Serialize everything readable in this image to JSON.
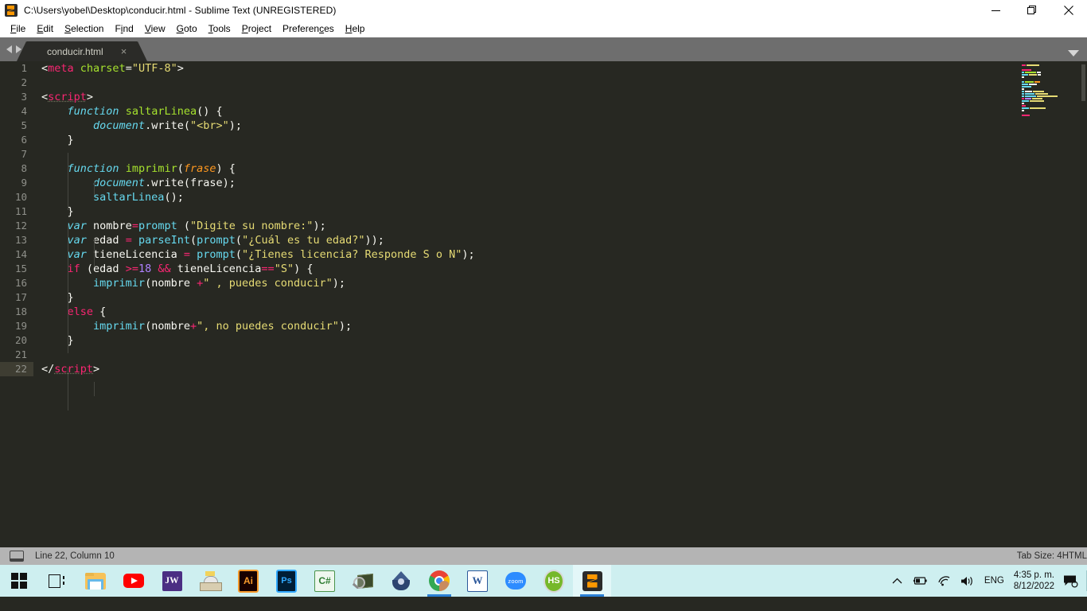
{
  "window": {
    "title": "C:\\Users\\yobel\\Desktop\\conducir.html - Sublime Text (UNREGISTERED)",
    "app_icon": "sublime-logo-icon",
    "controls": {
      "minimize": "minimize-icon",
      "restore": "restore-icon",
      "close": "close-icon"
    }
  },
  "menubar": {
    "items": [
      {
        "label": "File",
        "accel_index": 0
      },
      {
        "label": "Edit",
        "accel_index": 0
      },
      {
        "label": "Selection",
        "accel_index": 0
      },
      {
        "label": "Find",
        "accel_index": 1
      },
      {
        "label": "View",
        "accel_index": 0
      },
      {
        "label": "Goto",
        "accel_index": 0
      },
      {
        "label": "Tools",
        "accel_index": 0
      },
      {
        "label": "Project",
        "accel_index": 0
      },
      {
        "label": "Preferences",
        "accel_index": 8
      },
      {
        "label": "Help",
        "accel_index": 0
      }
    ]
  },
  "tabbar": {
    "nav_prev": "chevron-left-icon",
    "nav_next": "chevron-right-icon",
    "dropdown": "chevron-down-icon",
    "tabs": [
      {
        "label": "conducir.html",
        "active": true,
        "close": "×"
      }
    ]
  },
  "editor": {
    "active_line": 22,
    "lines": [
      {
        "n": 1,
        "tokens": [
          {
            "t": "&lt;",
            "c": "t-punct"
          },
          {
            "t": "meta",
            "c": "t-tag"
          },
          {
            "t": " ",
            "c": "t-plain"
          },
          {
            "t": "charset",
            "c": "t-attr"
          },
          {
            "t": "=",
            "c": "t-punct"
          },
          {
            "t": "\"UTF-8\"",
            "c": "t-str"
          },
          {
            "t": "&gt;",
            "c": "t-punct"
          }
        ]
      },
      {
        "n": 2,
        "tokens": []
      },
      {
        "n": 3,
        "tokens": [
          {
            "t": "&lt;",
            "c": "t-punct"
          },
          {
            "t": "script",
            "c": "t-tag u-dot"
          },
          {
            "t": "&gt;",
            "c": "t-punct"
          }
        ]
      },
      {
        "n": 4,
        "tokens": [
          {
            "t": "    ",
            "c": "t-plain"
          },
          {
            "t": "function",
            "c": "t-kw"
          },
          {
            "t": " ",
            "c": "t-plain"
          },
          {
            "t": "saltarLinea",
            "c": "t-fn"
          },
          {
            "t": "() {",
            "c": "t-plain"
          }
        ]
      },
      {
        "n": 5,
        "tokens": [
          {
            "t": "        ",
            "c": "t-plain"
          },
          {
            "t": "document",
            "c": "t-obj"
          },
          {
            "t": ".",
            "c": "t-plain"
          },
          {
            "t": "write",
            "c": "t-plain"
          },
          {
            "t": "(",
            "c": "t-plain"
          },
          {
            "t": "\"&lt;br&gt;\"",
            "c": "t-str"
          },
          {
            "t": ");",
            "c": "t-plain"
          }
        ]
      },
      {
        "n": 6,
        "tokens": [
          {
            "t": "    }",
            "c": "t-plain"
          }
        ]
      },
      {
        "n": 7,
        "tokens": []
      },
      {
        "n": 8,
        "tokens": [
          {
            "t": "    ",
            "c": "t-plain"
          },
          {
            "t": "function",
            "c": "t-kw"
          },
          {
            "t": " ",
            "c": "t-plain"
          },
          {
            "t": "imprimir",
            "c": "t-fn"
          },
          {
            "t": "(",
            "c": "t-plain"
          },
          {
            "t": "frase",
            "c": "t-param"
          },
          {
            "t": ") {",
            "c": "t-plain"
          }
        ]
      },
      {
        "n": 9,
        "tokens": [
          {
            "t": "        ",
            "c": "t-plain"
          },
          {
            "t": "document",
            "c": "t-obj"
          },
          {
            "t": ".",
            "c": "t-plain"
          },
          {
            "t": "write",
            "c": "t-plain"
          },
          {
            "t": "(frase);",
            "c": "t-plain"
          }
        ]
      },
      {
        "n": 10,
        "tokens": [
          {
            "t": "        ",
            "c": "t-plain"
          },
          {
            "t": "saltarLinea",
            "c": "t-call"
          },
          {
            "t": "();",
            "c": "t-plain"
          }
        ]
      },
      {
        "n": 11,
        "tokens": [
          {
            "t": "    }",
            "c": "t-plain"
          }
        ]
      },
      {
        "n": 12,
        "tokens": [
          {
            "t": "    ",
            "c": "t-plain"
          },
          {
            "t": "var",
            "c": "t-kw"
          },
          {
            "t": " nombre",
            "c": "t-plain"
          },
          {
            "t": "=",
            "c": "t-op"
          },
          {
            "t": "prompt",
            "c": "t-call"
          },
          {
            "t": " (",
            "c": "t-plain"
          },
          {
            "t": "\"Digite su nombre:\"",
            "c": "t-str"
          },
          {
            "t": ");",
            "c": "t-plain"
          }
        ]
      },
      {
        "n": 13,
        "tokens": [
          {
            "t": "    ",
            "c": "t-plain"
          },
          {
            "t": "var",
            "c": "t-kw"
          },
          {
            "t": " edad ",
            "c": "t-plain"
          },
          {
            "t": "=",
            "c": "t-op"
          },
          {
            "t": " ",
            "c": "t-plain"
          },
          {
            "t": "parseInt",
            "c": "t-call"
          },
          {
            "t": "(",
            "c": "t-plain"
          },
          {
            "t": "prompt",
            "c": "t-call"
          },
          {
            "t": "(",
            "c": "t-plain"
          },
          {
            "t": "\"¿Cuál es tu edad?\"",
            "c": "t-str"
          },
          {
            "t": "));",
            "c": "t-plain"
          }
        ]
      },
      {
        "n": 14,
        "tokens": [
          {
            "t": "    ",
            "c": "t-plain"
          },
          {
            "t": "var",
            "c": "t-kw"
          },
          {
            "t": " tieneLicencia ",
            "c": "t-plain"
          },
          {
            "t": "=",
            "c": "t-op"
          },
          {
            "t": " ",
            "c": "t-plain"
          },
          {
            "t": "prompt",
            "c": "t-call"
          },
          {
            "t": "(",
            "c": "t-plain"
          },
          {
            "t": "\"¿Tienes licencia? Responde S o N\"",
            "c": "t-str"
          },
          {
            "t": ");",
            "c": "t-plain"
          }
        ]
      },
      {
        "n": 15,
        "tokens": [
          {
            "t": "    ",
            "c": "t-plain"
          },
          {
            "t": "if",
            "c": "t-op"
          },
          {
            "t": " (edad ",
            "c": "t-plain"
          },
          {
            "t": "&gt;=",
            "c": "t-op"
          },
          {
            "t": "18",
            "c": "t-num"
          },
          {
            "t": " ",
            "c": "t-plain"
          },
          {
            "t": "&amp;&amp;",
            "c": "t-op"
          },
          {
            "t": " tieneLicencia",
            "c": "t-plain"
          },
          {
            "t": "==",
            "c": "t-op"
          },
          {
            "t": "\"S\"",
            "c": "t-str"
          },
          {
            "t": ") {",
            "c": "t-plain"
          }
        ]
      },
      {
        "n": 16,
        "tokens": [
          {
            "t": "        ",
            "c": "t-plain"
          },
          {
            "t": "imprimir",
            "c": "t-call"
          },
          {
            "t": "(nombre ",
            "c": "t-plain"
          },
          {
            "t": "+",
            "c": "t-op"
          },
          {
            "t": "\" , puedes conducir\"",
            "c": "t-str"
          },
          {
            "t": ");",
            "c": "t-plain"
          }
        ]
      },
      {
        "n": 17,
        "tokens": [
          {
            "t": "    }",
            "c": "t-plain"
          }
        ]
      },
      {
        "n": 18,
        "tokens": [
          {
            "t": "    ",
            "c": "t-plain"
          },
          {
            "t": "else",
            "c": "t-op"
          },
          {
            "t": " {",
            "c": "t-plain"
          }
        ]
      },
      {
        "n": 19,
        "tokens": [
          {
            "t": "        ",
            "c": "t-plain"
          },
          {
            "t": "imprimir",
            "c": "t-call"
          },
          {
            "t": "(nombre",
            "c": "t-plain"
          },
          {
            "t": "+",
            "c": "t-op"
          },
          {
            "t": "\", no puedes conducir\"",
            "c": "t-str"
          },
          {
            "t": ");",
            "c": "t-plain"
          }
        ]
      },
      {
        "n": 20,
        "tokens": [
          {
            "t": "    }",
            "c": "t-plain"
          }
        ]
      },
      {
        "n": 21,
        "tokens": []
      },
      {
        "n": 22,
        "tokens": [
          {
            "t": "&lt;/",
            "c": "t-punct"
          },
          {
            "t": "script",
            "c": "t-tag u-dot"
          },
          {
            "t": "&gt;",
            "c": "t-punct"
          }
        ]
      }
    ]
  },
  "statusbar": {
    "sidebar_icon": "sidebar-toggle-icon",
    "position": "Line 22, Column 10",
    "tab_size": "Tab Size: 4",
    "syntax": "HTML"
  },
  "taskbar": {
    "buttons": [
      {
        "name": "start-button",
        "icon": "windows-logo-icon",
        "label": "",
        "state": "idle"
      },
      {
        "name": "task-view-button",
        "icon": "task-view-icon",
        "label": "",
        "state": "idle"
      },
      {
        "name": "file-explorer-button",
        "icon": "folder-icon",
        "label": "",
        "state": "idle"
      },
      {
        "name": "youtube-button",
        "icon": "youtube-icon",
        "label": "",
        "state": "idle"
      },
      {
        "name": "jw-library-button",
        "icon": "jw-icon",
        "label": "JW",
        "state": "idle"
      },
      {
        "name": "library-button",
        "icon": "library-icon",
        "label": "",
        "state": "idle"
      },
      {
        "name": "illustrator-button",
        "icon": "illustrator-icon",
        "label": "Ai",
        "state": "idle"
      },
      {
        "name": "photoshop-button",
        "icon": "photoshop-icon",
        "label": "Ps",
        "state": "idle"
      },
      {
        "name": "csharp-button",
        "icon": "csharp-icon",
        "label": "C#",
        "state": "idle"
      },
      {
        "name": "inspect-tool-button",
        "icon": "magnifier-icon",
        "label": "",
        "state": "idle"
      },
      {
        "name": "virtualbox-button",
        "icon": "virtualbox-icon",
        "label": "",
        "state": "idle"
      },
      {
        "name": "chrome-button",
        "icon": "chrome-icon",
        "label": "",
        "state": "running"
      },
      {
        "name": "word-button",
        "icon": "word-icon",
        "label": "W",
        "state": "idle"
      },
      {
        "name": "zoom-button",
        "icon": "zoom-icon",
        "label": "zoom",
        "state": "idle"
      },
      {
        "name": "heidisql-button",
        "icon": "heidisql-icon",
        "label": "HS",
        "state": "idle"
      },
      {
        "name": "sublime-text-button",
        "icon": "sublime-icon",
        "label": "",
        "state": "focused"
      }
    ],
    "tray": {
      "overflow": "show-hidden-icons-chevron",
      "battery": "battery-charging-icon",
      "network": "wifi-icon",
      "volume": "speaker-icon",
      "language": "ENG",
      "time": "4:35 p. m.",
      "date": "8/12/2022",
      "notifications": "notification-center-icon"
    }
  },
  "minimap": {
    "rows": [
      [
        {
          "w": 5,
          "c": "#f92672"
        },
        {
          "w": 16,
          "c": "#e6db74"
        }
      ],
      [],
      [
        {
          "w": 12,
          "c": "#f92672"
        }
      ],
      [
        {
          "w": 3,
          "c": "#66d9ef"
        },
        {
          "w": 14,
          "c": "#a6e22e"
        },
        {
          "w": 5,
          "c": "#f8f8f2"
        }
      ],
      [
        {
          "w": 8,
          "c": "#66d9ef"
        },
        {
          "w": 10,
          "c": "#e6db74"
        },
        {
          "w": 4,
          "c": "#f8f8f2"
        }
      ],
      [
        {
          "w": 3,
          "c": "#f8f8f2"
        }
      ],
      [],
      [
        {
          "w": 3,
          "c": "#66d9ef"
        },
        {
          "w": 11,
          "c": "#a6e22e"
        },
        {
          "w": 7,
          "c": "#fd971f"
        }
      ],
      [
        {
          "w": 8,
          "c": "#66d9ef"
        },
        {
          "w": 10,
          "c": "#f8f8f2"
        }
      ],
      [
        {
          "w": 12,
          "c": "#66d9ef"
        }
      ],
      [
        {
          "w": 3,
          "c": "#f8f8f2"
        }
      ],
      [
        {
          "w": 3,
          "c": "#66d9ef"
        },
        {
          "w": 9,
          "c": "#f8f8f2"
        },
        {
          "w": 14,
          "c": "#e6db74"
        }
      ],
      [
        {
          "w": 3,
          "c": "#66d9ef"
        },
        {
          "w": 12,
          "c": "#66d9ef"
        },
        {
          "w": 16,
          "c": "#e6db74"
        }
      ],
      [
        {
          "w": 3,
          "c": "#66d9ef"
        },
        {
          "w": 14,
          "c": "#66d9ef"
        },
        {
          "w": 26,
          "c": "#e6db74"
        }
      ],
      [
        {
          "w": 3,
          "c": "#f92672"
        },
        {
          "w": 8,
          "c": "#ae81ff"
        },
        {
          "w": 13,
          "c": "#e6db74"
        }
      ],
      [
        {
          "w": 9,
          "c": "#66d9ef"
        },
        {
          "w": 18,
          "c": "#e6db74"
        }
      ],
      [
        {
          "w": 3,
          "c": "#f8f8f2"
        }
      ],
      [
        {
          "w": 5,
          "c": "#f92672"
        }
      ],
      [
        {
          "w": 9,
          "c": "#66d9ef"
        },
        {
          "w": 20,
          "c": "#e6db74"
        }
      ],
      [
        {
          "w": 3,
          "c": "#f8f8f2"
        }
      ],
      [],
      [
        {
          "w": 10,
          "c": "#f92672"
        }
      ]
    ]
  }
}
